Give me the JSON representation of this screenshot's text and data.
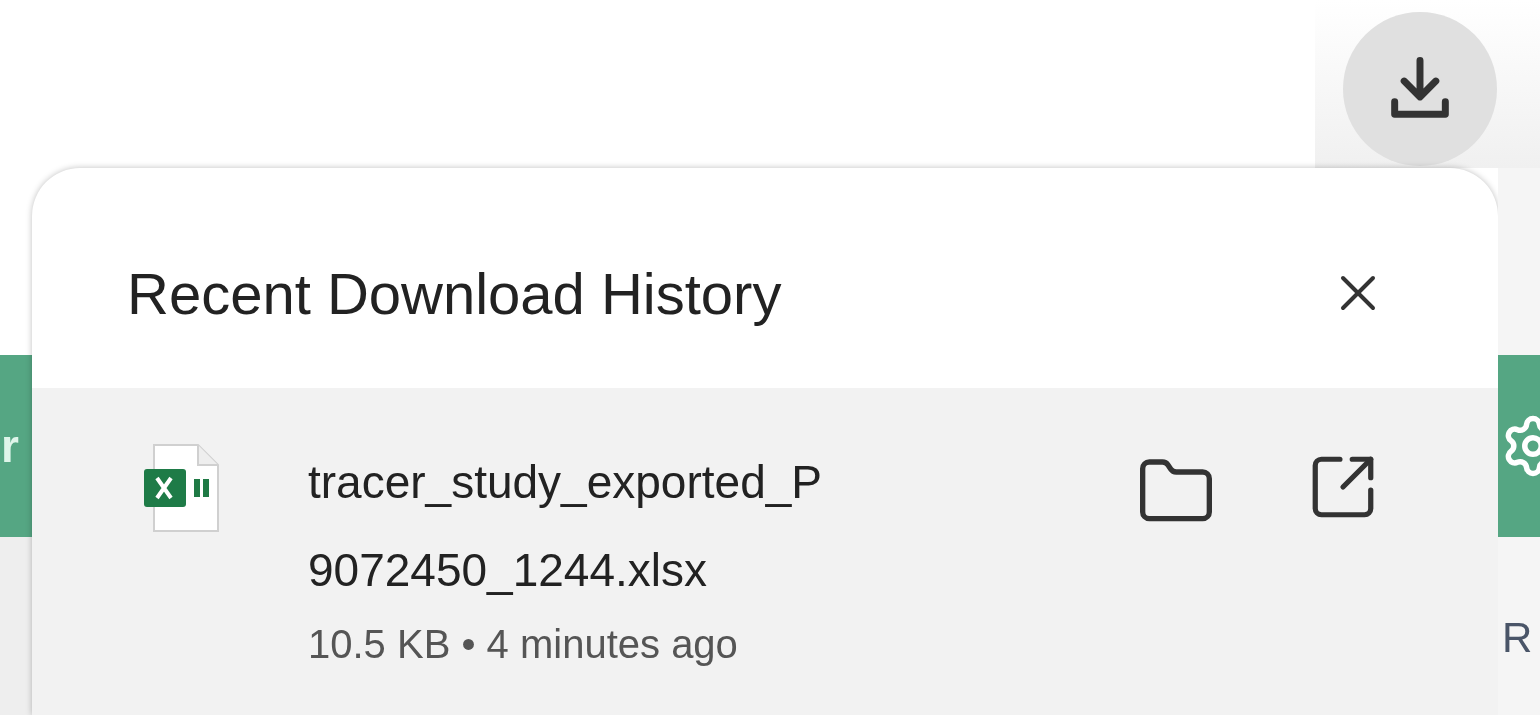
{
  "background": {
    "left_fragment": "r",
    "right_fragment": "R"
  },
  "popup": {
    "title": "Recent Download History",
    "downloads": [
      {
        "name_lines": [
          "tracer_study_exported_P",
          "9072450_1244.xlsx"
        ],
        "size": "10.5 KB",
        "separator": "•",
        "time": "4 minutes ago"
      }
    ]
  }
}
